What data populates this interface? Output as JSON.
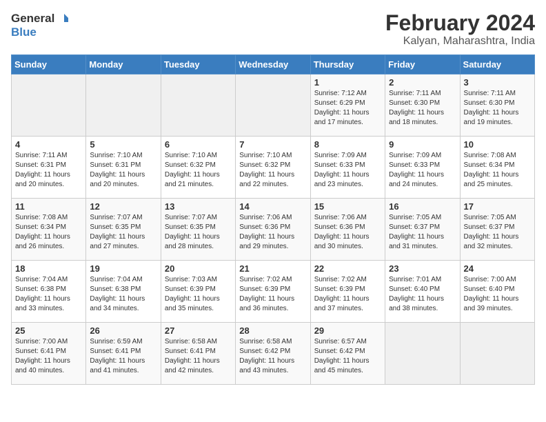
{
  "header": {
    "logo_general": "General",
    "logo_blue": "Blue",
    "title": "February 2024",
    "subtitle": "Kalyan, Maharashtra, India"
  },
  "days_of_week": [
    "Sunday",
    "Monday",
    "Tuesday",
    "Wednesday",
    "Thursday",
    "Friday",
    "Saturday"
  ],
  "weeks": [
    [
      {
        "day": null
      },
      {
        "day": null
      },
      {
        "day": null
      },
      {
        "day": null
      },
      {
        "day": 1,
        "sunrise": "7:12 AM",
        "sunset": "6:29 PM",
        "daylight": "11 hours and 17 minutes."
      },
      {
        "day": 2,
        "sunrise": "7:11 AM",
        "sunset": "6:30 PM",
        "daylight": "11 hours and 18 minutes."
      },
      {
        "day": 3,
        "sunrise": "7:11 AM",
        "sunset": "6:30 PM",
        "daylight": "11 hours and 19 minutes."
      }
    ],
    [
      {
        "day": 4,
        "sunrise": "7:11 AM",
        "sunset": "6:31 PM",
        "daylight": "11 hours and 20 minutes."
      },
      {
        "day": 5,
        "sunrise": "7:10 AM",
        "sunset": "6:31 PM",
        "daylight": "11 hours and 20 minutes."
      },
      {
        "day": 6,
        "sunrise": "7:10 AM",
        "sunset": "6:32 PM",
        "daylight": "11 hours and 21 minutes."
      },
      {
        "day": 7,
        "sunrise": "7:10 AM",
        "sunset": "6:32 PM",
        "daylight": "11 hours and 22 minutes."
      },
      {
        "day": 8,
        "sunrise": "7:09 AM",
        "sunset": "6:33 PM",
        "daylight": "11 hours and 23 minutes."
      },
      {
        "day": 9,
        "sunrise": "7:09 AM",
        "sunset": "6:33 PM",
        "daylight": "11 hours and 24 minutes."
      },
      {
        "day": 10,
        "sunrise": "7:08 AM",
        "sunset": "6:34 PM",
        "daylight": "11 hours and 25 minutes."
      }
    ],
    [
      {
        "day": 11,
        "sunrise": "7:08 AM",
        "sunset": "6:34 PM",
        "daylight": "11 hours and 26 minutes."
      },
      {
        "day": 12,
        "sunrise": "7:07 AM",
        "sunset": "6:35 PM",
        "daylight": "11 hours and 27 minutes."
      },
      {
        "day": 13,
        "sunrise": "7:07 AM",
        "sunset": "6:35 PM",
        "daylight": "11 hours and 28 minutes."
      },
      {
        "day": 14,
        "sunrise": "7:06 AM",
        "sunset": "6:36 PM",
        "daylight": "11 hours and 29 minutes."
      },
      {
        "day": 15,
        "sunrise": "7:06 AM",
        "sunset": "6:36 PM",
        "daylight": "11 hours and 30 minutes."
      },
      {
        "day": 16,
        "sunrise": "7:05 AM",
        "sunset": "6:37 PM",
        "daylight": "11 hours and 31 minutes."
      },
      {
        "day": 17,
        "sunrise": "7:05 AM",
        "sunset": "6:37 PM",
        "daylight": "11 hours and 32 minutes."
      }
    ],
    [
      {
        "day": 18,
        "sunrise": "7:04 AM",
        "sunset": "6:38 PM",
        "daylight": "11 hours and 33 minutes."
      },
      {
        "day": 19,
        "sunrise": "7:04 AM",
        "sunset": "6:38 PM",
        "daylight": "11 hours and 34 minutes."
      },
      {
        "day": 20,
        "sunrise": "7:03 AM",
        "sunset": "6:39 PM",
        "daylight": "11 hours and 35 minutes."
      },
      {
        "day": 21,
        "sunrise": "7:02 AM",
        "sunset": "6:39 PM",
        "daylight": "11 hours and 36 minutes."
      },
      {
        "day": 22,
        "sunrise": "7:02 AM",
        "sunset": "6:39 PM",
        "daylight": "11 hours and 37 minutes."
      },
      {
        "day": 23,
        "sunrise": "7:01 AM",
        "sunset": "6:40 PM",
        "daylight": "11 hours and 38 minutes."
      },
      {
        "day": 24,
        "sunrise": "7:00 AM",
        "sunset": "6:40 PM",
        "daylight": "11 hours and 39 minutes."
      }
    ],
    [
      {
        "day": 25,
        "sunrise": "7:00 AM",
        "sunset": "6:41 PM",
        "daylight": "11 hours and 40 minutes."
      },
      {
        "day": 26,
        "sunrise": "6:59 AM",
        "sunset": "6:41 PM",
        "daylight": "11 hours and 41 minutes."
      },
      {
        "day": 27,
        "sunrise": "6:58 AM",
        "sunset": "6:41 PM",
        "daylight": "11 hours and 42 minutes."
      },
      {
        "day": 28,
        "sunrise": "6:58 AM",
        "sunset": "6:42 PM",
        "daylight": "11 hours and 43 minutes."
      },
      {
        "day": 29,
        "sunrise": "6:57 AM",
        "sunset": "6:42 PM",
        "daylight": "11 hours and 45 minutes."
      },
      {
        "day": null
      },
      {
        "day": null
      }
    ]
  ],
  "labels": {
    "sunrise": "Sunrise:",
    "sunset": "Sunset:",
    "daylight": "Daylight:"
  }
}
